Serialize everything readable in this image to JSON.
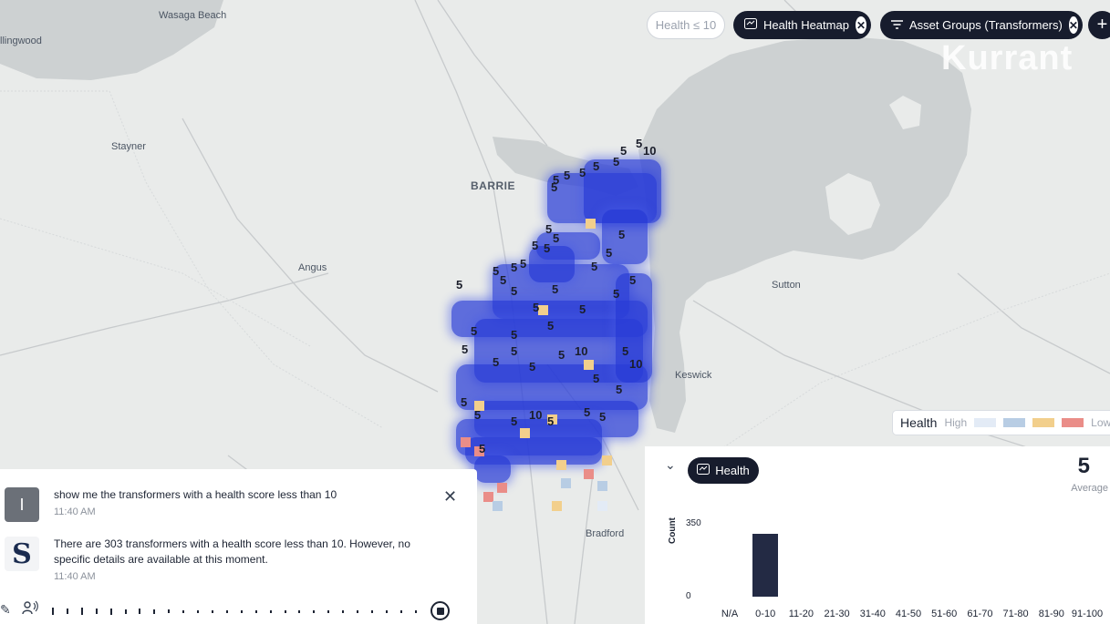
{
  "map": {
    "places": [
      {
        "name": "Wasaga Beach",
        "kind": "town"
      },
      {
        "name": "llingwood",
        "kind": "town"
      },
      {
        "name": "Stayner",
        "kind": "town"
      },
      {
        "name": "BARRIE",
        "kind": "city"
      },
      {
        "name": "Angus",
        "kind": "town"
      },
      {
        "name": "Sutton",
        "kind": "town"
      },
      {
        "name": "Keswick",
        "kind": "town"
      },
      {
        "name": "Bradford",
        "kind": "town"
      }
    ],
    "watermark": "Kurrant",
    "colors": {
      "water": "#cdd1d2",
      "land": "#e9ebea",
      "heat_high": "#3040d6"
    }
  },
  "filters": {
    "health_filter": "Health ≤ 10",
    "heatmap_label": "Health Heatmap",
    "asset_group_label": "Asset Groups (Transformers)",
    "add_label": "+"
  },
  "legend": {
    "title": "Health",
    "high_label": "High",
    "low_label": "Low",
    "colors": [
      "#e3ebf6",
      "#b8cde4",
      "#f2cf8c",
      "#ea8d88"
    ]
  },
  "chat": {
    "messages": [
      {
        "avatar": "I",
        "text": "show me the transformers with a health score less than 10",
        "time": "11:40 AM"
      },
      {
        "avatar": "S",
        "text": "There are 303 transformers with a health score less than 10. However, no specific details are available at this moment.",
        "time": "11:40 AM"
      }
    ]
  },
  "stats": {
    "tab_label": "Health",
    "average_value": "5",
    "average_label": "Average"
  },
  "chart_data": {
    "type": "bar",
    "categories": [
      "N/A",
      "0-10",
      "11-20",
      "21-30",
      "31-40",
      "41-50",
      "51-60",
      "61-70",
      "71-80",
      "81-90",
      "91-100"
    ],
    "values": [
      0,
      303,
      0,
      0,
      0,
      0,
      0,
      0,
      0,
      0,
      0
    ],
    "ylabel": "Count",
    "ylim": [
      0,
      350
    ],
    "yticks": [
      "0",
      "350"
    ]
  }
}
